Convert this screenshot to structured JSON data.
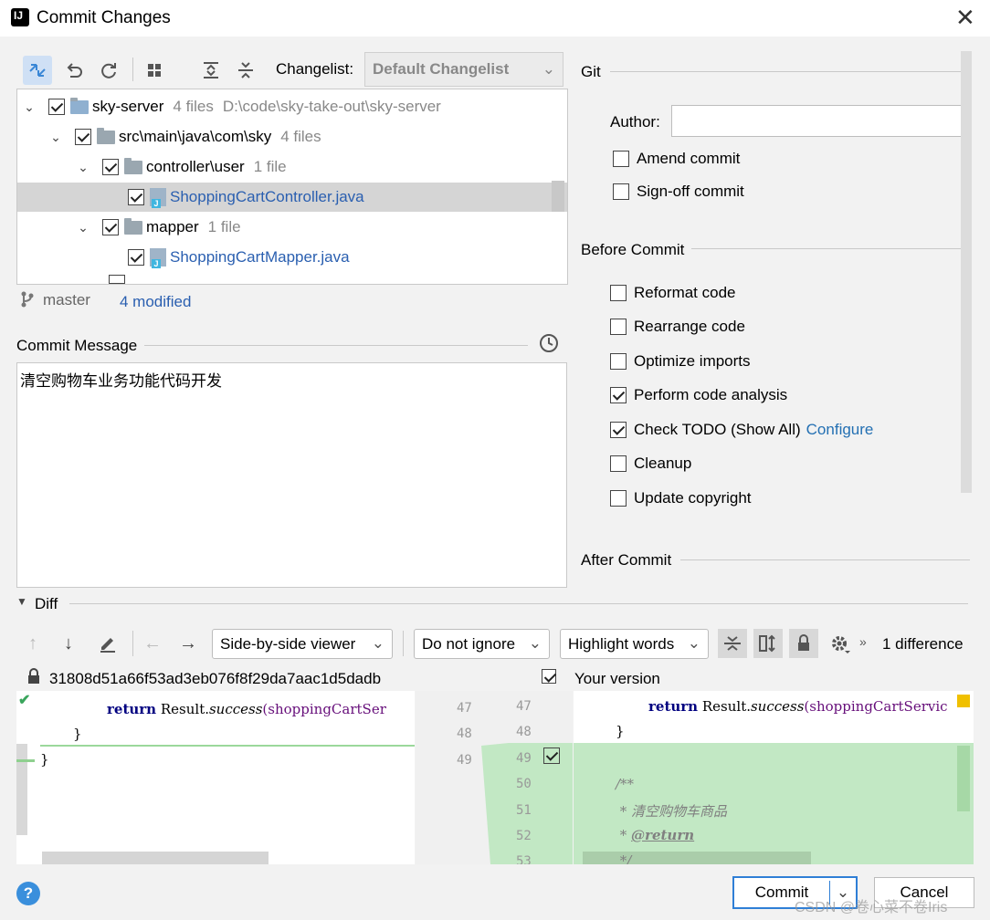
{
  "window": {
    "title": "Commit Changes"
  },
  "toolbar": {
    "changelist_label": "Changelist:",
    "changelist_value": "Default Changelist"
  },
  "tree": {
    "root": {
      "name": "sky-server",
      "count": "4 files",
      "path": "D:\\code\\sky-take-out\\sky-server"
    },
    "src": {
      "name": "src\\main\\java\\com\\sky",
      "count": "4 files"
    },
    "controller": {
      "name": "controller\\user",
      "count": "1 file"
    },
    "controller_file": "ShoppingCartController.java",
    "mapper": {
      "name": "mapper",
      "count": "1 file"
    },
    "mapper_file": "ShoppingCartMapper.java"
  },
  "status": {
    "branch": "master",
    "modified": "4 modified"
  },
  "commit_message": {
    "label": "Commit Message",
    "text": "清空购物车业务功能代码开发"
  },
  "git": {
    "section": "Git",
    "author_label": "Author:",
    "author_value": "",
    "amend": "Amend commit",
    "signoff": "Sign-off commit"
  },
  "before_commit": {
    "section": "Before Commit",
    "options": [
      {
        "label": "Reformat code",
        "checked": false
      },
      {
        "label": "Rearrange code",
        "checked": false
      },
      {
        "label": "Optimize imports",
        "checked": false
      },
      {
        "label": "Perform code analysis",
        "checked": true
      },
      {
        "label": "Check TODO (Show All)",
        "checked": true
      },
      {
        "label": "Cleanup",
        "checked": false
      },
      {
        "label": "Update copyright",
        "checked": false
      }
    ],
    "configure_link": "Configure"
  },
  "after_commit": {
    "section": "After Commit"
  },
  "diff": {
    "section": "Diff",
    "viewer": "Side-by-side viewer",
    "ignore": "Do not ignore",
    "highlight": "Highlight words",
    "difference_count": "1 difference",
    "left_header": "31808d51a66f53ad3eb076f8f29da7aac1d5dadb",
    "right_header": "Your version",
    "left_lines": [
      "47",
      "48",
      "49"
    ],
    "right_lines": [
      "47",
      "48",
      "49",
      "50",
      "51",
      "52",
      "53"
    ],
    "left_code": {
      "line1_kw": "return",
      "line1_rest": " Result.",
      "line1_method": "success",
      "line1_arg": "(shoppingCartSer",
      "line2": "}",
      "line3": "}"
    },
    "right_code": {
      "line1_kw": "return",
      "line1_rest": " Result.",
      "line1_method": "success",
      "line1_arg": "(shoppingCartServic",
      "line2": "}",
      "line4": "/**",
      "line5": " * 清空购物车商品",
      "line6_star": " * ",
      "line6_tag": "@return",
      "line7": " */"
    }
  },
  "footer": {
    "commit": "Commit",
    "cancel": "Cancel",
    "watermark": "CSDN @卷心菜不卷Iris"
  },
  "colors": {
    "added_bg": "#c2e8c4",
    "accent_blue": "#2470b3"
  }
}
